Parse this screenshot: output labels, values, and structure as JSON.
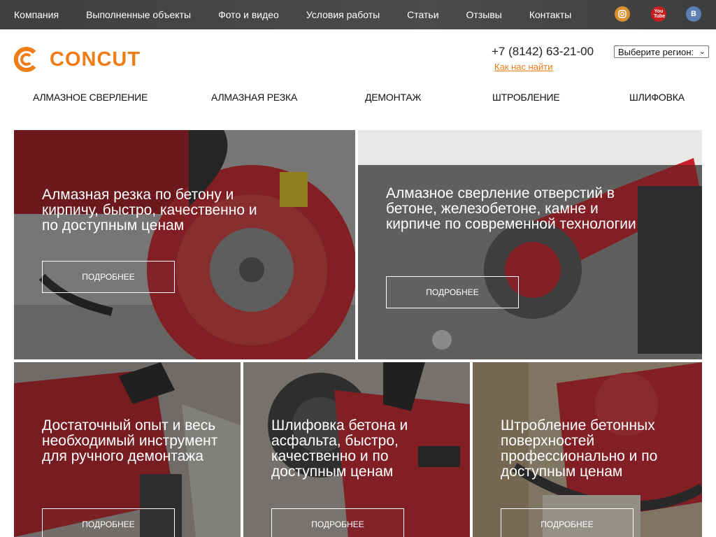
{
  "topnav": [
    "Компания",
    "Выполненные объекты",
    "Фото и видео",
    "Условия работы",
    "Статьи",
    "Отзывы",
    "Контакты"
  ],
  "social": {
    "instagram_icon": "instagram-icon",
    "youtube_label": "You Tube",
    "vk_label": "B"
  },
  "logo": {
    "text": "CONCUT"
  },
  "contact": {
    "phone": "+7 (8142) 63-21-00",
    "findus": "Как нас найти",
    "region": "Выберите регион:"
  },
  "mainnav": [
    "АЛМАЗНОЕ СВЕРЛЕНИЕ",
    "АЛМАЗНАЯ РЕЗКА",
    "ДЕМОНТАЖ",
    "ШТРОБЛЕНИЕ",
    "ШЛИФОВКА"
  ],
  "cards": [
    {
      "title": "Алмазная резка по бетону и кирпичу, быстро, качественно и по доступным ценам",
      "button": "ПОДРОБНЕЕ"
    },
    {
      "title": "Алмазное сверление отверстий в бетоне, железобетоне, камне и кирпиче по современной технологии",
      "button": "ПОДРОБНЕЕ"
    },
    {
      "title": "Достаточный опыт и весь необходимый инструмент для ручного демонтажа",
      "button": "ПОДРОБНЕЕ"
    },
    {
      "title": "Шлифовка бетона и асфальта, быстро, качественно и по доступным ценам",
      "button": "ПОДРОБНЕЕ"
    },
    {
      "title": "Штробление бетонных поверхностей профессионально и по доступным ценам",
      "button": "ПОДРОБНЕЕ"
    }
  ],
  "colors": {
    "accent": "#f07c16",
    "topbar": "#444444",
    "tool_red": "#c8202a"
  }
}
